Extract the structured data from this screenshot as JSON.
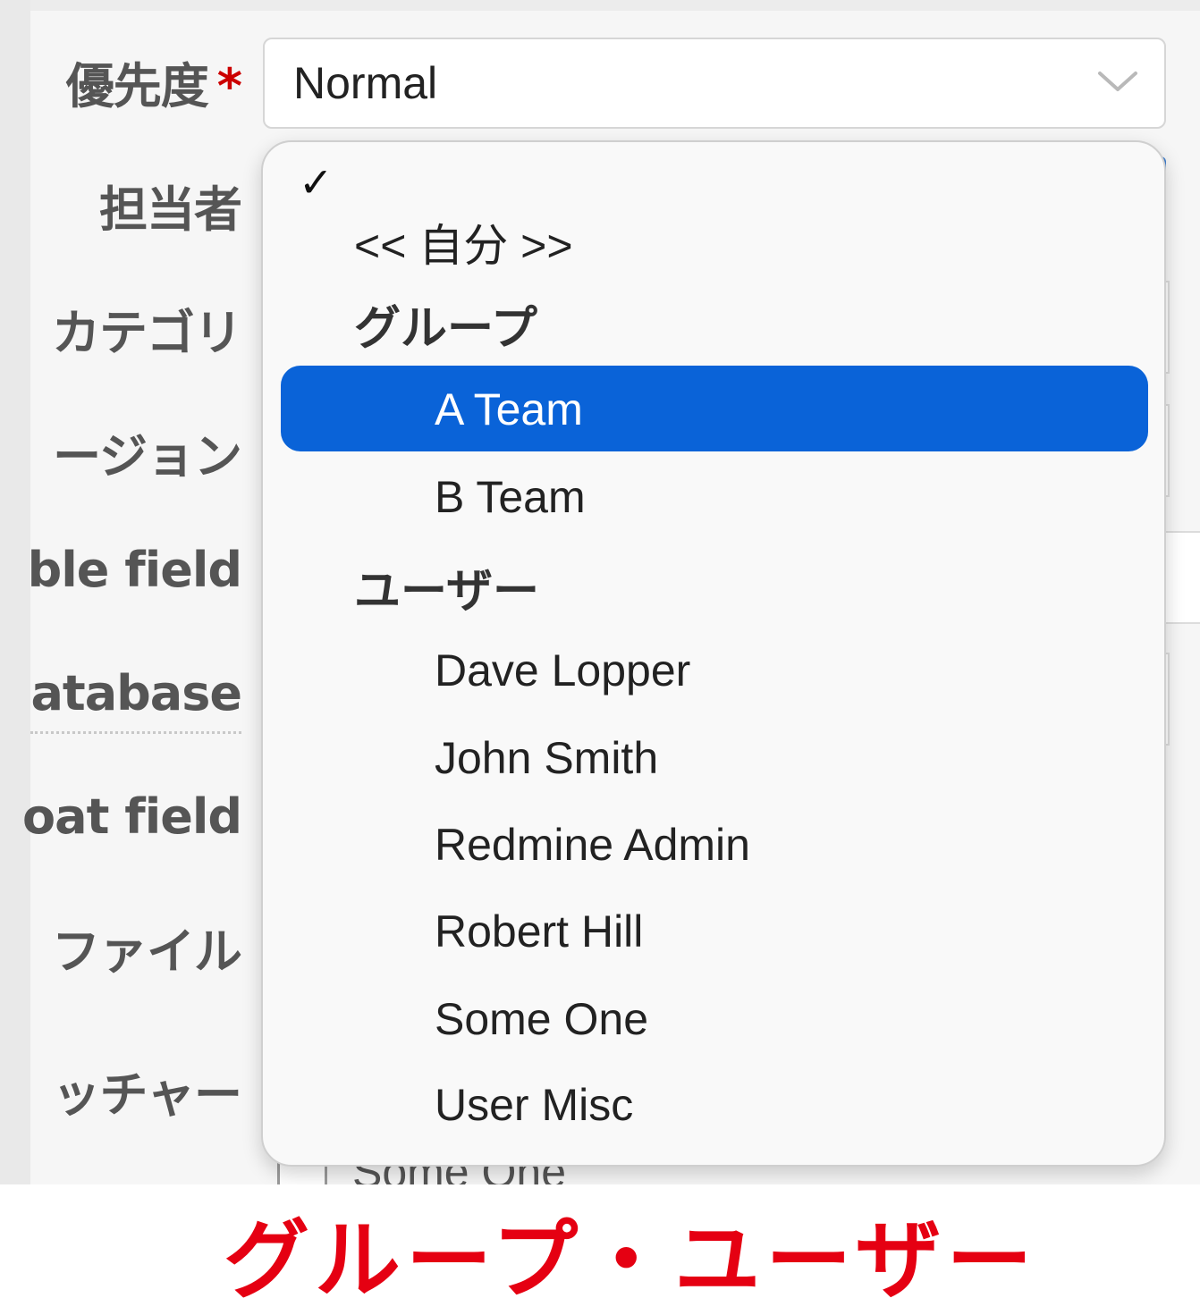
{
  "form": {
    "labels": {
      "priority": "優先度",
      "required_mark": "*",
      "assignee": "担当者",
      "category": "カテゴリ",
      "version": "ージョン",
      "field1": "ble field",
      "field2": "atabase",
      "field3": "oat field",
      "file": "ファイル",
      "watcher": "ッチャー"
    },
    "priority_value": "Normal",
    "behind_checkbox_label": "Some One"
  },
  "dropdown": {
    "selected_check": "✓",
    "self_option": "<< 自分 >>",
    "group_header": "グループ",
    "groups": [
      "A Team",
      "B Team"
    ],
    "highlighted": "A Team",
    "user_header": "ユーザー",
    "users": [
      "Dave Lopper",
      "John Smith",
      "Redmine Admin",
      "Robert Hill",
      "Some One",
      "User Misc"
    ]
  },
  "caption": "グループ・ユーザー",
  "colors": {
    "highlight": "#0a63d8",
    "required": "#cc0000",
    "caption": "#e50012"
  }
}
